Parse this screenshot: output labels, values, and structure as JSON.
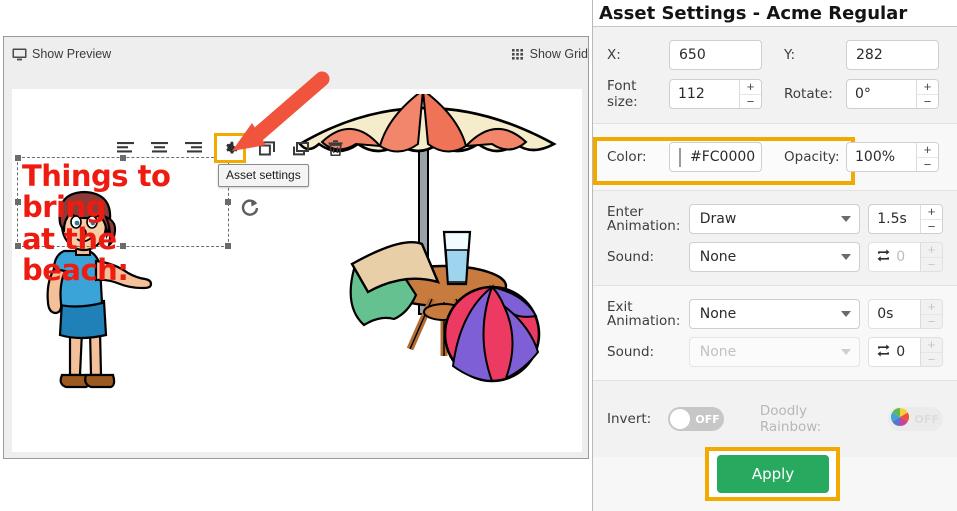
{
  "editor": {
    "show_preview_label": "Show Preview",
    "show_grid_label": "Show Grid",
    "tooltip": "Asset settings",
    "asset_text": "Things to bring\nat the beach:",
    "asset_text_color": "#ee1b11",
    "toolbar_buttons": [
      {
        "name": "align-left-icon",
        "label": "Align left"
      },
      {
        "name": "align-center-icon",
        "label": "Align center"
      },
      {
        "name": "align-right-icon",
        "label": "Align right"
      },
      {
        "name": "gear-icon",
        "label": "Asset settings"
      },
      {
        "name": "duplicate-icon",
        "label": "Duplicate"
      },
      {
        "name": "bring-forward-icon",
        "label": "Bring forward"
      },
      {
        "name": "trash-icon",
        "label": "Delete"
      }
    ],
    "highlight_color": "#F2A900",
    "annotation_arrow_color": "#f0543c"
  },
  "settings": {
    "title": "Asset Settings - Acme Regular",
    "position": {
      "x_label": "X:",
      "x_value": "650",
      "y_label": "Y:",
      "y_value": "282",
      "font_size_label": "Font size:",
      "font_size_value": "112",
      "rotate_label": "Rotate:",
      "rotate_value": "0°"
    },
    "color": {
      "color_label": "Color:",
      "color_value": "#FC0000",
      "swatch_hex": "#FC0000",
      "opacity_label": "Opacity:",
      "opacity_value": "100%"
    },
    "enter": {
      "animation_label": "Enter Animation:",
      "animation_value": "Draw",
      "duration_value": "1.5s",
      "sound_label": "Sound:",
      "sound_value": "None",
      "loop_value": "0"
    },
    "exit": {
      "animation_label": "Exit Animation:",
      "animation_value": "None",
      "duration_value": "0s",
      "sound_label": "Sound:",
      "sound_value": "None",
      "loop_value": "0"
    },
    "toggles": {
      "invert_label": "Invert:",
      "invert_state": "OFF",
      "rainbow_label": "Doodly Rainbow:",
      "rainbow_state": "OFF"
    },
    "apply_label": "Apply",
    "apply_color": "#27aa5f"
  }
}
